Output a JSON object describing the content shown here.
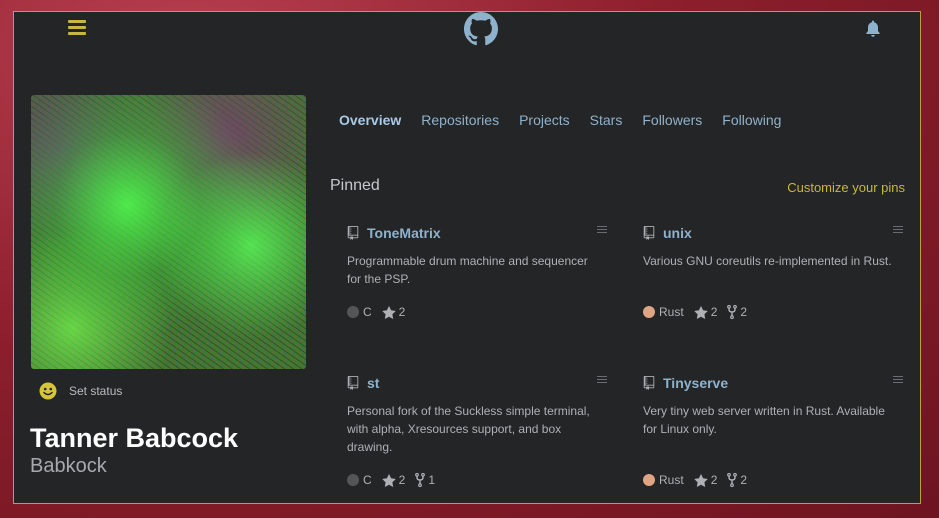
{
  "header": {
    "menu_icon": "hamburger-menu-icon",
    "logo_icon": "github-octocat-icon",
    "notifications_icon": "bell-icon",
    "accent_color": "#c9b640"
  },
  "profile": {
    "status_label": "Set status",
    "full_name": "Tanner Babcock",
    "username": "Babkock"
  },
  "tabs": [
    {
      "label": "Overview",
      "active": true
    },
    {
      "label": "Repositories",
      "active": false
    },
    {
      "label": "Projects",
      "active": false
    },
    {
      "label": "Stars",
      "active": false
    },
    {
      "label": "Followers",
      "active": false
    },
    {
      "label": "Following",
      "active": false
    }
  ],
  "pinned": {
    "title": "Pinned",
    "customize_label": "Customize your pins",
    "repos": [
      {
        "name": "ToneMatrix",
        "description": "Programmable drum machine and sequencer for the PSP.",
        "language": "C",
        "language_color": "#555555",
        "stars": "2",
        "forks": ""
      },
      {
        "name": "unix",
        "description": "Various GNU coreutils re-implemented in Rust.",
        "language": "Rust",
        "language_color": "#dea584",
        "stars": "2",
        "forks": "2"
      },
      {
        "name": "st",
        "description": "Personal fork of the Suckless simple terminal, with alpha, Xresources support, and box drawing.",
        "language": "C",
        "language_color": "#555555",
        "stars": "2",
        "forks": "1"
      },
      {
        "name": "Tinyserve",
        "description": "Very tiny web server written in Rust. Available for Linux only.",
        "language": "Rust",
        "language_color": "#dea584",
        "stars": "2",
        "forks": "2"
      }
    ]
  }
}
